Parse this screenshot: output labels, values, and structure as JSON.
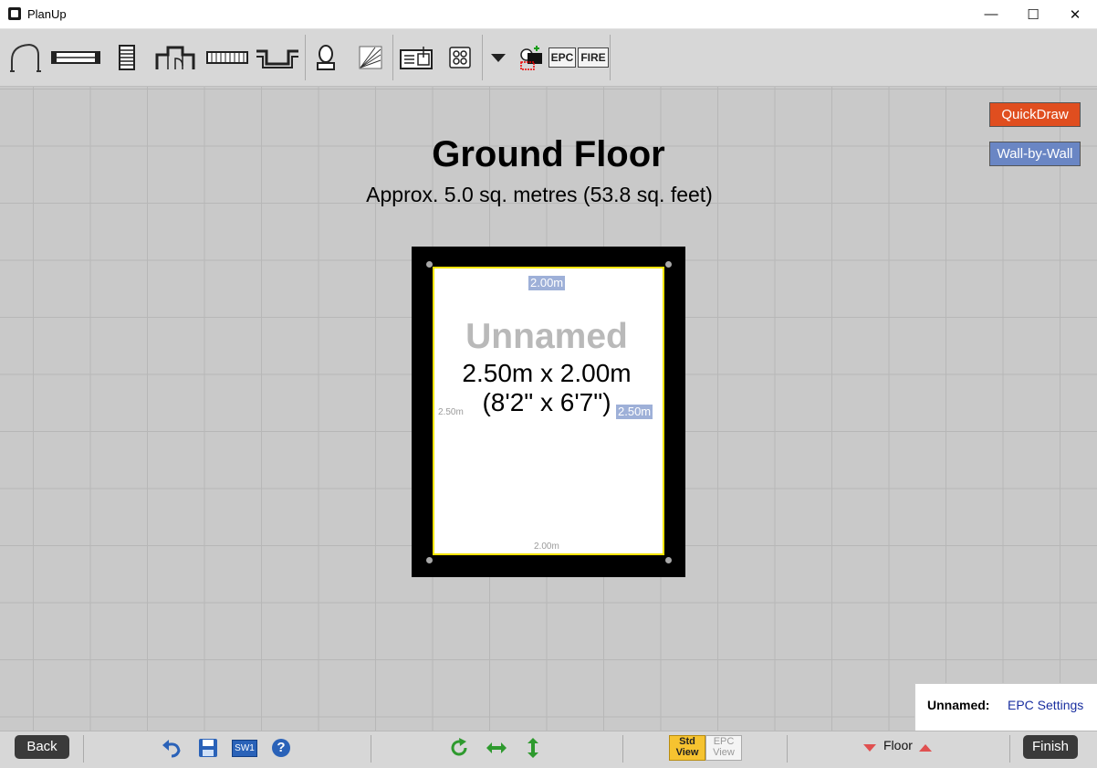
{
  "window": {
    "title": "PlanUp",
    "minimize": "—",
    "maximize": "☐",
    "close": "✕"
  },
  "toolbar": {
    "epc_label": "EPC",
    "fire_label": "FIRE"
  },
  "modes": {
    "quickdraw": "QuickDraw",
    "wall_by_wall": "Wall-by-Wall",
    "quickdraw_color": "#e04e1f",
    "wall_color": "#6a86c4"
  },
  "floor": {
    "title": "Ground Floor",
    "area": "Approx. 5.0 sq. metres (53.8 sq. feet)"
  },
  "room": {
    "name": "Unnamed",
    "dimensions_metric": "2.50m x 2.00m",
    "dimensions_imperial": "(8'2\" x 6'7\")",
    "top_label": "2.00m",
    "bottom_label": "2.00m",
    "left_label": "2.50m",
    "right_label": "2.50m"
  },
  "epc": {
    "room_label": "Unnamed:",
    "settings_link": "EPC Settings"
  },
  "bottombar": {
    "back": "Back",
    "finish": "Finish",
    "sw1": "SW1",
    "help": "?",
    "std_view_line1": "Std",
    "std_view_line2": "View",
    "epc_view_line1": "EPC",
    "epc_view_line2": "View",
    "floor_label": "Floor"
  }
}
